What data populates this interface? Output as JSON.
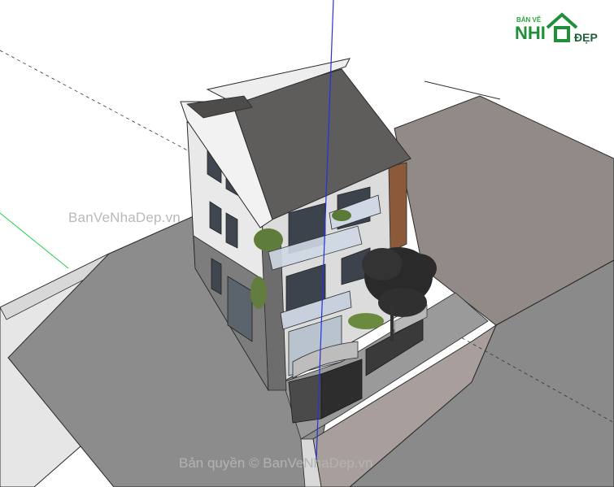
{
  "app": {
    "name": "SketchUp 3D model viewport"
  },
  "watermarks": {
    "center": "BanVeNhaDep.vn",
    "copyright": "Bản quyền © BanVeNhaDep.vn",
    "logo_top": "BẢN VẼ",
    "logo_nhi": "NHI",
    "logo_dep": "ĐẸP"
  },
  "colors": {
    "ground_paving": "#8f8886",
    "road": "#8c8c8c",
    "sidewalk": "#cfcfcf",
    "roof": "#5f5d5b",
    "wall_light": "#e8e8e8",
    "wall_dark": "#7a7a7a",
    "glass": "#3f4650",
    "wood_accent": "#8a5a3a",
    "axis_blue": "#2233dd",
    "axis_green": "#22cc44",
    "logo_green": "#1f8f3a"
  }
}
